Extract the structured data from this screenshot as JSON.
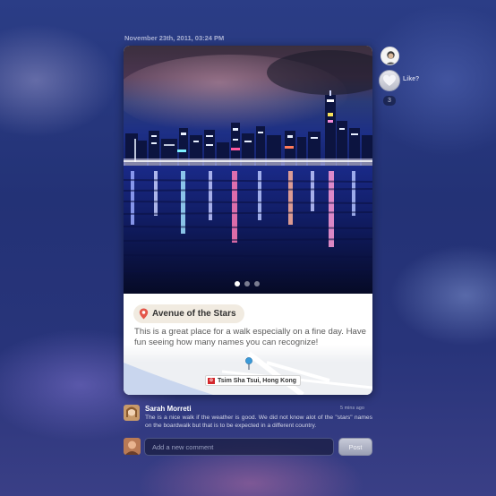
{
  "post": {
    "timestamp": "November 23th, 2011, 03:24 PM",
    "place_name": "Avenue of the Stars",
    "description": "This is a great place for a walk especially on a fine day. Have fun seeing how many names you can recognize!",
    "location": "Tsim Sha Tsui, Hong Kong",
    "carousel": {
      "total": 3,
      "active": 1
    }
  },
  "sidebar": {
    "like_label": "Like?",
    "like_count": "3"
  },
  "comment": {
    "author": "Sarah Morreti",
    "time": "5 mins ago",
    "text": "The is a nice walk if the weather is good. We did not know alot of the \"stars\" names on the boardwalk but that is to be expected in a different country."
  },
  "compose": {
    "placeholder": "Add a new comment",
    "post_label": "Post"
  },
  "colors": {
    "background": "#233276",
    "pill": "#f1ebe1",
    "pin": "#e4574b",
    "flag": "#d3262b"
  },
  "icons": [
    "pin-icon",
    "heart-icon",
    "flag-icon",
    "map-pin-icon"
  ]
}
